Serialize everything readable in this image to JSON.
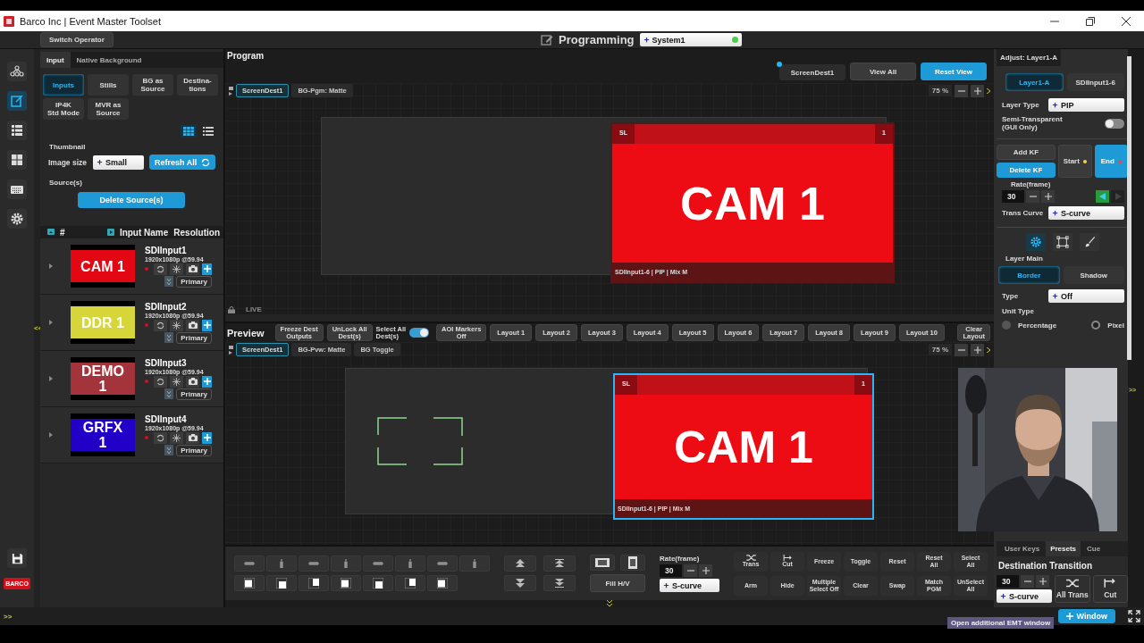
{
  "window": {
    "title": "Barco Inc | Event Master Toolset"
  },
  "top_bar": {
    "operator_button": "Switch Operator",
    "mode": "Programming",
    "system": "System1",
    "system_online": true
  },
  "rail": [
    {
      "kind": "nodes",
      "selected": false
    },
    {
      "kind": "edit",
      "selected": true
    },
    {
      "kind": "list",
      "selected": false
    },
    {
      "kind": "tiles",
      "selected": false
    },
    {
      "kind": "keyboard",
      "selected": false
    },
    {
      "kind": "gear",
      "selected": false
    }
  ],
  "rail_bottom": {
    "logo": "BARCO"
  },
  "left_panel": {
    "tabs": [
      {
        "label": "Input",
        "selected": true
      },
      {
        "label": "Native Background",
        "selected": false
      }
    ],
    "source_tabs": [
      {
        "lines": [
          "Inputs"
        ],
        "selected": true
      },
      {
        "lines": [
          "Stills"
        ],
        "selected": false
      },
      {
        "lines": [
          "BG as",
          "Source"
        ],
        "selected": false
      },
      {
        "lines": [
          "Destina-",
          "tions"
        ],
        "selected": false
      },
      {
        "lines": [
          "IP4K",
          "Std Mode"
        ],
        "selected": false
      },
      {
        "lines": [
          "MVR as",
          "Source"
        ],
        "selected": false
      }
    ],
    "view_modes": [
      {
        "kind": "grid",
        "selected": true
      },
      {
        "kind": "list",
        "selected": false
      }
    ],
    "thumbnail_label": "Thumbnail",
    "image_size_label": "Image size",
    "image_size": "Small",
    "refresh_button": "Refresh All",
    "sources_label": "Source(s)",
    "delete_button": "Delete Source(s)",
    "columns": [
      "#",
      "Input Name",
      "Resolution"
    ],
    "inputs": [
      {
        "thumb": [
          "CAM 1"
        ],
        "color": "#e30613",
        "name": "SDIInput1",
        "resolution": "1920x1080p @59.94",
        "connector": "Primary"
      },
      {
        "thumb": [
          "DDR 1"
        ],
        "color": "#d6d63a",
        "name": "SDIInput2",
        "resolution": "1920x1080p @59.94",
        "connector": "Primary"
      },
      {
        "thumb": [
          "DEMO",
          "1"
        ],
        "color": "#a3343c",
        "name": "SDIInput3",
        "resolution": "1920x1080p @59.94",
        "connector": "Primary"
      },
      {
        "thumb": [
          "GRFX",
          "1"
        ],
        "color": "#2200c8",
        "name": "SDIInput4",
        "resolution": "1920x1080p @59.94",
        "connector": "Primary"
      }
    ]
  },
  "splitters": {
    "left": "<<",
    "right": ">>"
  },
  "program": {
    "title": "Program",
    "dest_button": "ScreenDest1",
    "dest_active": true,
    "view_all": "View All",
    "reset_view": "Reset View",
    "tabs": [
      {
        "label": "ScreenDest1",
        "selected": true
      },
      {
        "label": "BG-Pgm: Matte",
        "selected": false
      }
    ],
    "zoom": "75 %",
    "status": "LIVE",
    "layer": {
      "tag": "SL",
      "number": "1",
      "content": "CAM 1",
      "caption": "SDIInput1-6 | PIP | Mix M",
      "selected": false
    }
  },
  "preview": {
    "title": "Preview",
    "buttons": [
      [
        "Freeze Dest",
        "Outputs"
      ],
      [
        "UnLock All",
        "Dest(s)"
      ]
    ],
    "select_all": {
      "lines": [
        "Select All",
        "Dest(s)"
      ],
      "on": true
    },
    "aoi_button": [
      "AOI Markers",
      "Off"
    ],
    "layouts": [
      "Layout 1",
      "Layout 2",
      "Layout 3",
      "Layout 4",
      "Layout 5",
      "Layout 6",
      "Layout 7",
      "Layout 8",
      "Layout 9",
      "Layout 10"
    ],
    "clear_layout": [
      "Clear",
      "Layout"
    ],
    "tabs": [
      {
        "label": "ScreenDest1",
        "selected": true
      },
      {
        "label": "BG-Pvw: Matte",
        "selected": false
      },
      {
        "label": "BG Toggle",
        "selected": false
      }
    ],
    "zoom": "75 %",
    "layer": {
      "tag": "SL",
      "number": "1",
      "content": "CAM 1",
      "caption": "SDIInput1-6 | PIP | Mix M",
      "selected": true
    }
  },
  "toolbar": {
    "fill_button": "Fill H/V",
    "rate_label": "Rate(frame)",
    "rate": "30",
    "curve": "S-curve",
    "actions": [
      {
        "kind": "trans",
        "lines": [
          "Trans"
        ]
      },
      {
        "kind": "cut",
        "lines": [
          "Cut"
        ]
      },
      {
        "kind": "text",
        "lines": [
          "Freeze"
        ]
      },
      {
        "kind": "text",
        "lines": [
          "Toggle"
        ]
      },
      {
        "kind": "text",
        "lines": [
          "Reset"
        ]
      },
      {
        "kind": "text",
        "lines": [
          "Reset",
          "All"
        ]
      },
      {
        "kind": "text",
        "lines": [
          "Select",
          "All"
        ]
      },
      {
        "kind": "text",
        "lines": [
          "Arm"
        ]
      },
      {
        "kind": "text",
        "lines": [
          "Hide"
        ]
      },
      {
        "kind": "text",
        "lines": [
          "Multiple",
          "Select Off"
        ]
      },
      {
        "kind": "text",
        "lines": [
          "Clear"
        ]
      },
      {
        "kind": "text",
        "lines": [
          "Swap"
        ]
      },
      {
        "kind": "text",
        "lines": [
          "Match",
          "PGM"
        ]
      },
      {
        "kind": "text",
        "lines": [
          "UnSelect",
          "All"
        ]
      }
    ]
  },
  "adjust": {
    "title": "Adjust: Layer1-A",
    "tabs": [
      {
        "label": "Layer1-A",
        "selected": true
      },
      {
        "label": "SDIInput1-6",
        "selected": false
      }
    ],
    "layer_type_label": "Layer Type",
    "layer_type": "PIP",
    "semi_lines": [
      "Semi-Transparent",
      "(GUI Only)"
    ],
    "semi_on": false,
    "add_kf": "Add KF",
    "delete_kf": "Delete KF",
    "keyframes": [
      {
        "label": "Start",
        "selected": false,
        "color": "#e8d84a"
      },
      {
        "label": "End",
        "selected": true,
        "color": "#e04a5a"
      }
    ],
    "rate_label": "Rate(frame)",
    "rate": "30",
    "directions": [
      {
        "kind": "back",
        "selected": true
      },
      {
        "kind": "forward",
        "selected": false
      }
    ],
    "curve_label": "Trans Curve",
    "curve": "S-curve",
    "icon_tabs": [
      {
        "kind": "gear",
        "selected": true
      },
      {
        "kind": "crop",
        "selected": false
      },
      {
        "kind": "brush",
        "selected": false
      }
    ],
    "section": "Layer Main",
    "sub_tabs": [
      {
        "label": "Border",
        "selected": true
      },
      {
        "label": "Shadow",
        "selected": false
      }
    ],
    "type_label": "Type",
    "type": "Off",
    "unit_label": "Unit Type",
    "units": [
      {
        "label": "Percentage",
        "selected": false
      },
      {
        "label": "Pixel",
        "selected": true
      }
    ]
  },
  "transition_panel": {
    "tabs": [
      {
        "label": "User Keys",
        "selected": false
      },
      {
        "label": "Presets",
        "selected": true
      },
      {
        "label": "Cue",
        "selected": false
      }
    ],
    "title": "Destination Transition",
    "rate": "30",
    "curve": "S-curve",
    "buttons": [
      {
        "kind": "trans",
        "label": "All Trans"
      },
      {
        "kind": "cut",
        "label": "Cut"
      }
    ]
  },
  "status_bar": {
    "expand": ">>",
    "window_button": "Window",
    "tooltip": "Open additional EMT window"
  }
}
